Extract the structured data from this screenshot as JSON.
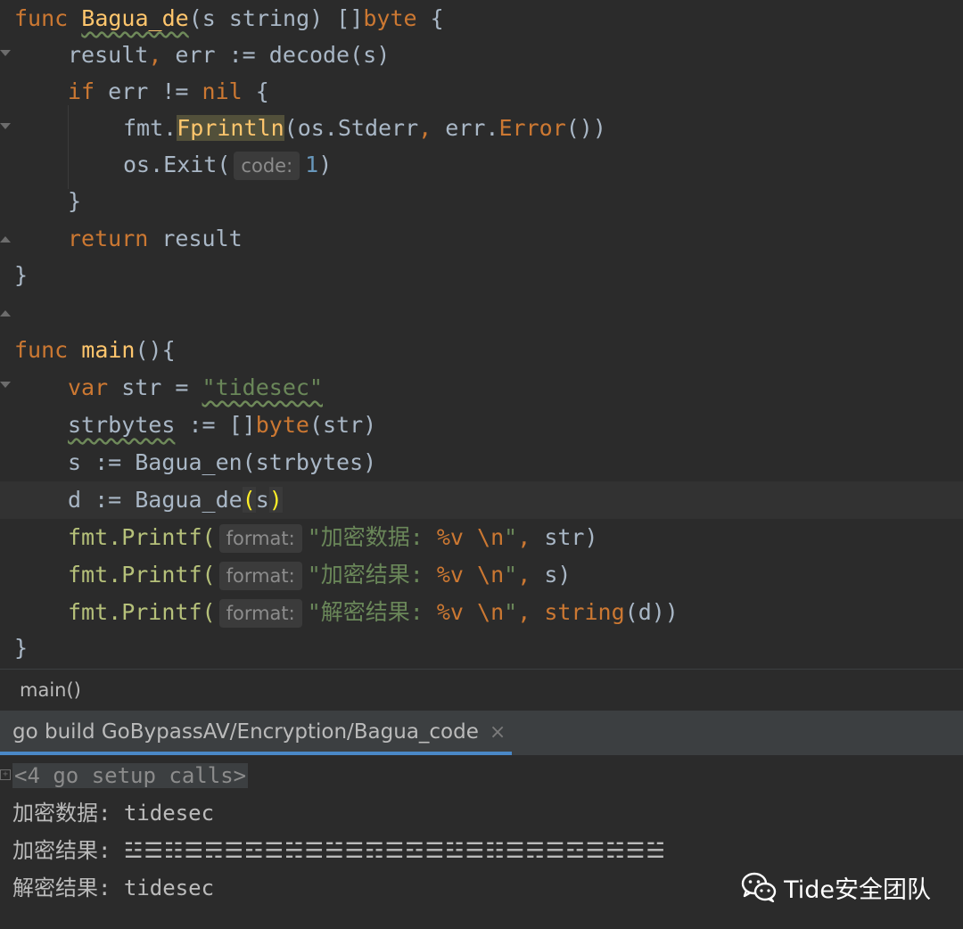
{
  "editor": {
    "lines": [
      {
        "t": "func_bagua_de"
      },
      {
        "t": "result_err"
      },
      {
        "t": "if_err"
      },
      {
        "t": "fprintln"
      },
      {
        "t": "exit"
      },
      {
        "t": "close_if"
      },
      {
        "t": "return"
      },
      {
        "t": "close_func"
      },
      {
        "t": "blank"
      },
      {
        "t": "func_main"
      },
      {
        "t": "var_str"
      },
      {
        "t": "strbytes"
      },
      {
        "t": "s_assign"
      },
      {
        "t": "d_assign"
      },
      {
        "t": "printf1"
      },
      {
        "t": "printf2"
      },
      {
        "t": "printf3"
      },
      {
        "t": "close_main"
      }
    ],
    "tokens": {
      "func": "func",
      "bagua_de": "Bagua_de",
      "sig1": "(s string) []",
      "byte": "byte",
      "brace_open": " {",
      "result_err": "result",
      "comma": ",",
      "err_assign": " err := decode(s)",
      "if": "if",
      "err_neq": " err != ",
      "nil": "nil",
      "brace": " {",
      "fmt_dot": "fmt.",
      "fprintln": "Fprintln",
      "fprintln_args1": "(os.Stderr",
      "fprintln_args2": " err.",
      "error_method": "Error",
      "fprintln_args3": "())",
      "os_exit": "os.Exit(",
      "code_hint": "code:",
      "one": "1",
      "close_paren": ")",
      "close_brace": "}",
      "return": "return",
      "result": " result",
      "main": "main",
      "main_sig": "(){",
      "var": "var",
      "str_eq": " str = ",
      "tidesec_str": "\"tidesec\"",
      "strbytes": "strbytes",
      "strbytes_rest": " := []",
      "strbytes_call": "(str)",
      "s_assign": "s := Bagua_en(strbytes)",
      "d_assign_pre": "d := Bagua_de",
      "paren_o": "(",
      "s": "s",
      "paren_c": ")",
      "fmt_printf": "fmt.Printf(",
      "format_hint": "format:",
      "fmt_str1": "\"加密数据: ",
      "fmt_str2": "\"加密结果: ",
      "fmt_str3": "\"解密结果: ",
      "verb": "%v",
      "newline": " \\n",
      "quote": "\"",
      "arg_str": " str)",
      "arg_s": " s)",
      "string_kw": "string",
      "arg_d": "(d))"
    }
  },
  "breadcrumb": {
    "label": "main()"
  },
  "run_panel": {
    "tab_label": "go build GoBypassAV/Encryption/Bagua_code",
    "close_glyph": "×"
  },
  "console": {
    "setup": "<4 go setup calls>",
    "line1": "加密数据: tidesec",
    "line2_prefix": "加密结果: ",
    "line2_value": "☳☰☷☰☴☰☲☰☵☰☱☰☶☰☲☰☳☰☷☰☴☰☲☰☵☰☱",
    "line3": "解密结果: tidesec"
  },
  "watermark": {
    "text": "Tide安全团队",
    "icon": "wechat-icon"
  },
  "colors": {
    "background": "#2b2b2b",
    "keyword": "#cc7832",
    "function": "#ffc66d",
    "string": "#6a8759",
    "number": "#6897bb",
    "text": "#a9b7c6",
    "tab_underline": "#4a88c7"
  }
}
